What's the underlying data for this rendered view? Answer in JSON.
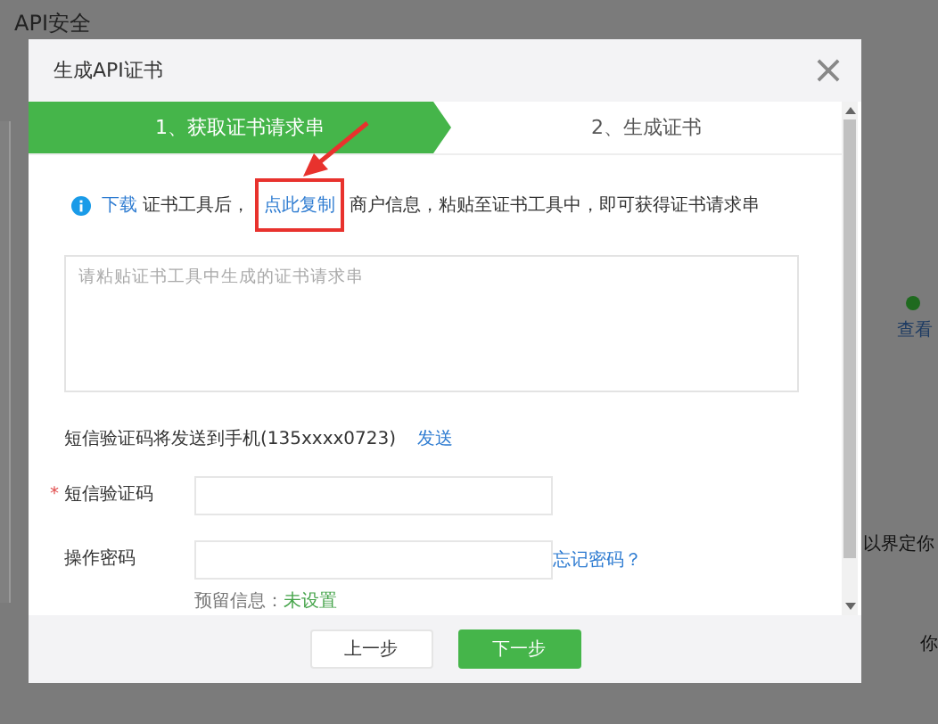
{
  "page": {
    "title": "API安全",
    "side_link": "查看",
    "side_text": "以界定你",
    "side_note": "你"
  },
  "dialog": {
    "title": "生成API证书",
    "steps": [
      {
        "label": "1、获取证书请求串",
        "selected": true
      },
      {
        "label": "2、生成证书",
        "selected": false
      }
    ],
    "notice": {
      "download_link": "下载",
      "text_before": "证书工具后，",
      "copy_link": "点此复制",
      "text_after": "商户信息，粘贴至证书工具中，即可获得证书请求串"
    },
    "request_field": {
      "placeholder": "请粘贴证书工具中生成的证书请求串"
    },
    "sms_notice": {
      "text": "短信验证码将发送到手机(135xxxx0723)",
      "send_link": "发送"
    },
    "fields": [
      {
        "required_mark": "*",
        "label": "短信验证码"
      },
      {
        "label": "操作密码",
        "link": "忘记密码？",
        "hint_label": "预留信息：",
        "hint_value": "未设置"
      }
    ],
    "buttons": [
      {
        "label": "上一步",
        "kind": "secondary"
      },
      {
        "label": "下一步",
        "kind": "primary"
      }
    ]
  }
}
